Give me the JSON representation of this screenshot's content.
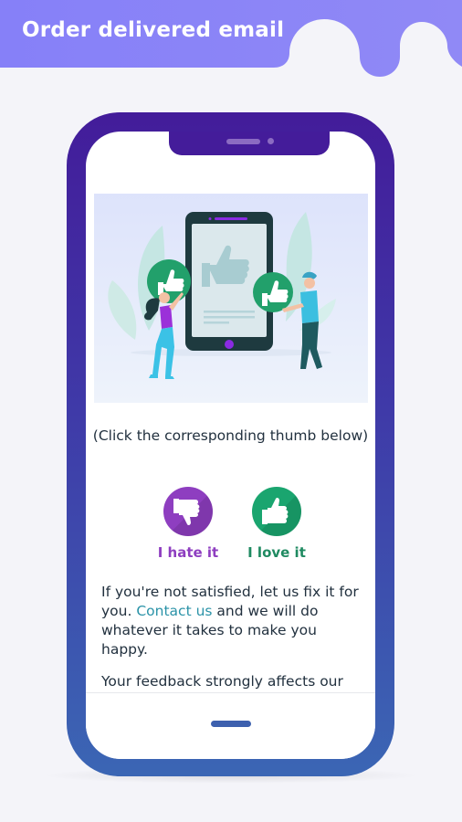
{
  "banner": {
    "title": "Order delivered email",
    "color": "#8882f8"
  },
  "phone": {
    "frame_color_top": "#431c9a",
    "frame_color_bottom": "#3b66b4"
  },
  "email": {
    "hero_image": "feedback-illustration",
    "instruction": "(Click the corresponding thumb below)",
    "votes": [
      {
        "label": "I hate it",
        "icon": "thumbs-down-icon",
        "color": "#8e3ec0"
      },
      {
        "label": "I love it",
        "icon": "thumbs-up-icon",
        "color": "#1aa56f"
      }
    ],
    "paragraph1": {
      "before": "If you're not satisfied, let us fix it for you. ",
      "link": "Contact us",
      "after": " and we will do whatever it takes to make you happy."
    },
    "paragraph2": "Your feedback strongly affects our"
  }
}
